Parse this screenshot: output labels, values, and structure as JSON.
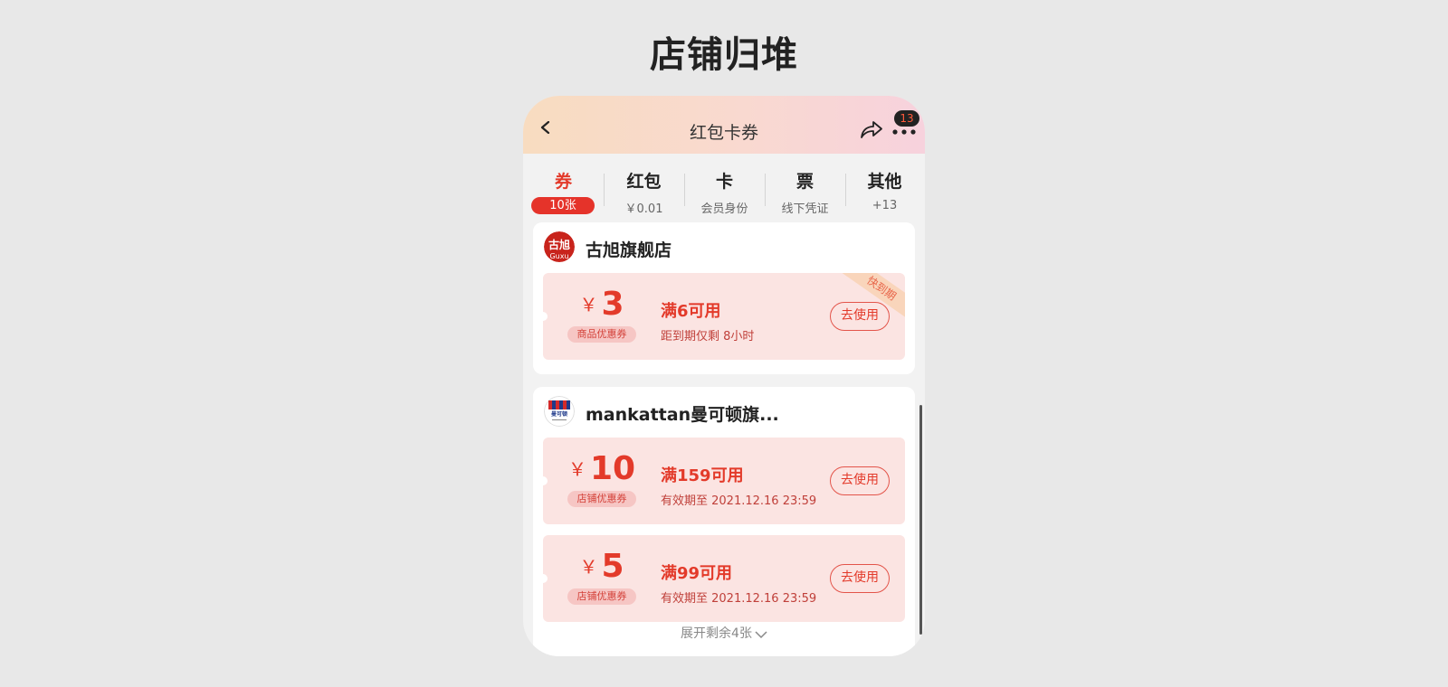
{
  "page": {
    "title": "店铺归堆"
  },
  "nav": {
    "title": "红包卡券",
    "badge": "13",
    "back_icon": "chevron-left-icon",
    "share_icon": "share-icon",
    "more_icon": "more-dots-icon"
  },
  "tabs": [
    {
      "label": "券",
      "sub": "10张",
      "active": true
    },
    {
      "label": "红包",
      "sub": "￥0.01"
    },
    {
      "label": "卡",
      "sub": "会员身份"
    },
    {
      "label": "票",
      "sub": "线下凭证"
    },
    {
      "label": "其他",
      "sub": "+13"
    }
  ],
  "stores": [
    {
      "name": "古旭旗舰店",
      "logo_text": "古旭",
      "logo_sub": "Guxu",
      "coupons": [
        {
          "currency": "￥",
          "amount": "3",
          "type": "商品优惠券",
          "condition": "满6可用",
          "validity": "距到期仅剩 8小时",
          "button": "去使用",
          "ribbon": "快到期"
        }
      ]
    },
    {
      "name": "mankattan曼可顿旗...",
      "logo_text": "曼可顿",
      "coupons": [
        {
          "currency": "￥",
          "amount": "10",
          "type": "店铺优惠券",
          "condition": "满159可用",
          "validity": "有效期至 2021.12.16 23:59",
          "button": "去使用"
        },
        {
          "currency": "￥",
          "amount": "5",
          "type": "店铺优惠券",
          "condition": "满99可用",
          "validity": "有效期至 2021.12.16 23:59",
          "button": "去使用"
        }
      ]
    }
  ],
  "expand": {
    "label": "展开剩余4张"
  },
  "colors": {
    "accent": "#e33a2a",
    "coupon_bg": "#fbe4e2",
    "nav_gradient_start": "#f8dcc0",
    "nav_gradient_end": "#f7d2dd"
  }
}
